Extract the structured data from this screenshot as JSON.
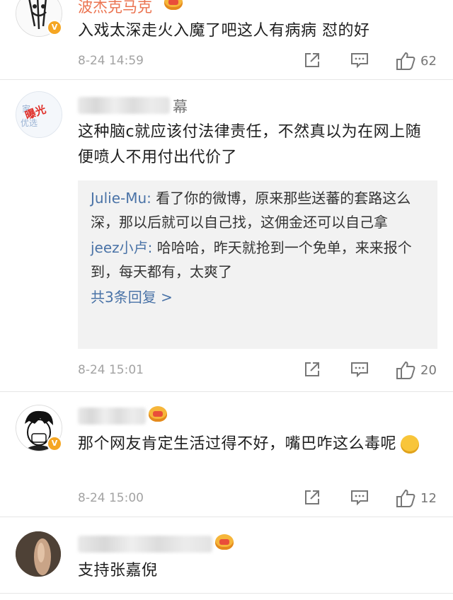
{
  "comments": [
    {
      "name": "波杰克马克",
      "text": "入戏太深走火入魔了吧这人有病病 怼的好",
      "time": "8-24 14:59",
      "likes": "62"
    },
    {
      "name_suffix": "幕",
      "avatar_text": "曝光",
      "text": "这种脑c就应该付法律责任，不然真以为在网上随便喷人不用付出代价了",
      "replies": [
        {
          "user": "Julie-Mu:",
          "text": " 看了你的微博，原来那些送蕃的套路这么深，那以后就可以自己找，这佣金还可以自己拿"
        },
        {
          "user": "jeez小卢:",
          "text": " 哈哈哈，昨天就抢到一个免单，来来报个到，每天都有，太爽了"
        }
      ],
      "more_replies": "共3条回复 >",
      "time": "8-24 15:01",
      "likes": "20"
    },
    {
      "text": "那个网友肯定生活过得不好，嘴巴咋这么毒呢",
      "time": "8-24 15:00",
      "likes": "12"
    },
    {
      "text": "支持张嘉倪"
    }
  ],
  "icons": {
    "share": "share-icon",
    "comment": "comment-icon",
    "like": "thumbs-up-icon",
    "verified": "verified-badge-icon",
    "crown": "vip-crown-icon"
  },
  "colors": {
    "name": "#eb7350",
    "link": "#4a73a7",
    "meta": "#a3a3a3"
  }
}
